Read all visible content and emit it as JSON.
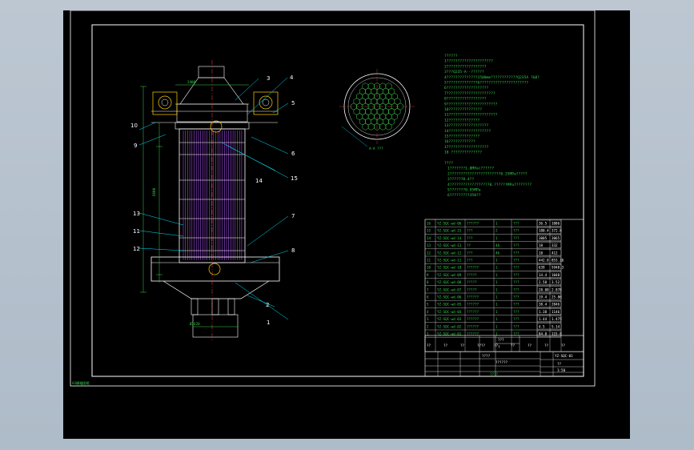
{
  "viewport": {
    "background": "#000000"
  },
  "colors": {
    "frame": "#ffffff",
    "geometry": "#ffffff",
    "leader": "#00e5ff",
    "dimension": "#3fd14f",
    "tube_bundle": "#a24be8",
    "center_line": "#ff4040",
    "motor": "#ffd200",
    "text_green": "#34d14a"
  },
  "corner_stamp": "A3横幅图框",
  "part_labels": [
    {
      "id": "1",
      "text": "1"
    },
    {
      "id": "2",
      "text": "2"
    },
    {
      "id": "3",
      "text": "3"
    },
    {
      "id": "4",
      "text": "4"
    },
    {
      "id": "5",
      "text": "5"
    },
    {
      "id": "6",
      "text": "6"
    },
    {
      "id": "7",
      "text": "7"
    },
    {
      "id": "8",
      "text": "8"
    },
    {
      "id": "9",
      "text": "9"
    },
    {
      "id": "10",
      "text": "10"
    },
    {
      "id": "11",
      "text": "11"
    },
    {
      "id": "12",
      "text": "12"
    },
    {
      "id": "13",
      "text": "13"
    },
    {
      "id": "14",
      "text": "14"
    },
    {
      "id": "15",
      "text": "15"
    }
  ],
  "section_label": "A-A ???",
  "dimensions": {
    "top_width": "2400",
    "height_main": "6600",
    "bottom_width": "Ø1420"
  },
  "tech_notes": [
    "??????",
    "1?????????????????????",
    "2??????????????????",
    "3???Q235-A--??????",
    "4??????????????1500mm????????????Q235A ?&8?",
    "5??????????????6??????????????????????",
    "6???????????????????",
    "7??????????????????????",
    "8??????????????????",
    "9???????????????????????",
    "10???????????????",
    "11??????????????????????",
    "12??????????????",
    "13??????????????????",
    "14???????????????????",
    "15??????????????",
    "16????????????",
    "17??????????????????",
    "18 ??????????????",
    "",
    "????",
    "1???????1.8MPa(??????",
    "2???????????????????????0.25MPa?????",
    "3??????0.4??",
    "4??????????????????0.??????MPa????????",
    "5???????0.95MPa",
    "6?????????350??"
  ],
  "parts_table": {
    "rows": [
      [
        "16",
        "YZ-SQC-wd-06",
        "??????",
        "1",
        "???",
        "36.5",
        "1086"
      ],
      [
        "15",
        "YZ-SQC-wd-15",
        "???",
        "2",
        "???",
        "180.4",
        "372.8"
      ],
      [
        "14",
        "YZ-SQC-wd-14",
        "???",
        "1",
        "???",
        "3005",
        "3065"
      ],
      [
        "13",
        "YZ-SQC-wd-13",
        "??",
        "46",
        "???",
        "18",
        "332"
      ],
      [
        "12",
        "YZ-SQC-wd-12",
        "???",
        "46",
        "???",
        "18",
        "412"
      ],
      [
        "11",
        "YZ-SQC-wd-11",
        "???",
        "1",
        "???",
        "442.8",
        "853.26"
      ],
      [
        "10",
        "YZ-SQC-wd-10",
        "??????",
        "1",
        "???",
        "639",
        "5940.3"
      ],
      [
        "9",
        "YZ-SQC-wd-09",
        "?????",
        "1",
        "???",
        "14.4",
        "1040"
      ],
      [
        "8",
        "YZ-SQC-wd-08",
        "?????",
        "1",
        "???",
        "2.58",
        "3.52"
      ],
      [
        "7",
        "YZ-SQC-wd-07",
        "?????",
        "1",
        "???",
        "28.08",
        "2.878"
      ],
      [
        "6",
        "YZ-SQC-wd-06",
        "??????",
        "1",
        "???",
        "19.4",
        "25.86"
      ],
      [
        "5",
        "YZ-SQC-wd-05",
        "??????",
        "1",
        "???",
        "38.4",
        "2046"
      ],
      [
        "4",
        "YZ-SQC-wd-04",
        "??????",
        "1",
        "???",
        "1.38",
        "1146"
      ],
      [
        "3",
        "YZ-SQC-wd-03",
        "??????",
        "1",
        "???",
        "1.44",
        "1.475"
      ],
      [
        "2",
        "YZ-SQC-wd-02",
        "??????",
        "1",
        "???",
        "4.5",
        "5.14"
      ],
      [
        "1",
        "YZ-SQC-wd-01",
        "??????",
        "1",
        "???",
        "84.8",
        "115.8"
      ]
    ],
    "header_tail": [
      "??",
      "??",
      "??",
      "????",
      "??",
      "??",
      "??",
      "??",
      "??"
    ]
  },
  "title_block": {
    "code": "YZ-SQC-01",
    "title": "??????",
    "mark": "????",
    "ratio": "1:50",
    "sheet": "??",
    "school": "????",
    "extra": "???",
    "sign": "?"
  }
}
